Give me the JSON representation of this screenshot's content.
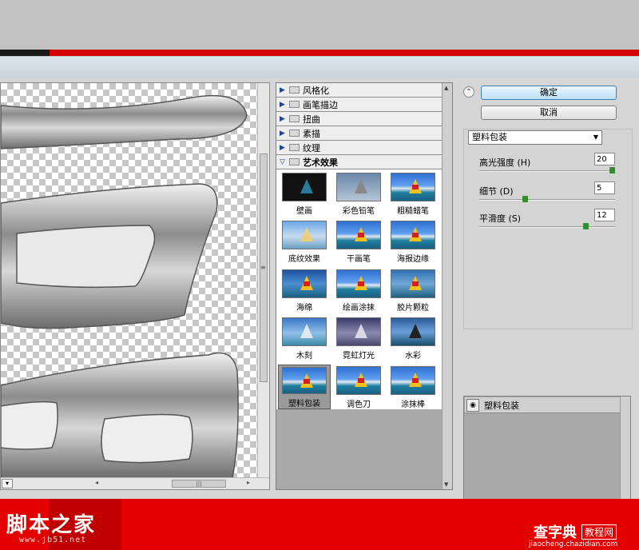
{
  "gallery": {
    "categories": [
      {
        "label": "风格化",
        "expanded": false
      },
      {
        "label": "画笔描边",
        "expanded": false
      },
      {
        "label": "扭曲",
        "expanded": false
      },
      {
        "label": "素描",
        "expanded": false
      },
      {
        "label": "纹理",
        "expanded": false
      },
      {
        "label": "艺术效果",
        "expanded": true
      }
    ],
    "filters": [
      {
        "label": "壁画"
      },
      {
        "label": "彩色铅笔"
      },
      {
        "label": "粗糙蜡笔"
      },
      {
        "label": "底纹效果"
      },
      {
        "label": "干画笔"
      },
      {
        "label": "海报边缘"
      },
      {
        "label": "海绵"
      },
      {
        "label": "绘画涂抹"
      },
      {
        "label": "胶片颗粒"
      },
      {
        "label": "木刻"
      },
      {
        "label": "霓虹灯光"
      },
      {
        "label": "水彩"
      },
      {
        "label": "塑料包装",
        "selected": true
      },
      {
        "label": "调色刀"
      },
      {
        "label": "涂抹棒"
      }
    ]
  },
  "panel": {
    "ok_label": "确定",
    "cancel_label": "取消",
    "filter_select": "塑料包装",
    "params": [
      {
        "label": "高光强度 (H)",
        "value": "20",
        "max": 20
      },
      {
        "label": "细节 (D)",
        "value": "5",
        "max": 15
      },
      {
        "label": "平滑度 (S)",
        "value": "12",
        "max": 15
      }
    ],
    "layer_label": "塑料包装"
  },
  "watermark": {
    "left_text": "脚本之家",
    "left_url": "www.jb51.net",
    "right_text": "查字典",
    "right_badge": "教程网",
    "right_url": "jiaocheng.chazidian.com"
  },
  "colors": {
    "accent_red": "#e20000",
    "ok_button": "#bde0f6",
    "slider_knob": "#2f8f2f"
  }
}
